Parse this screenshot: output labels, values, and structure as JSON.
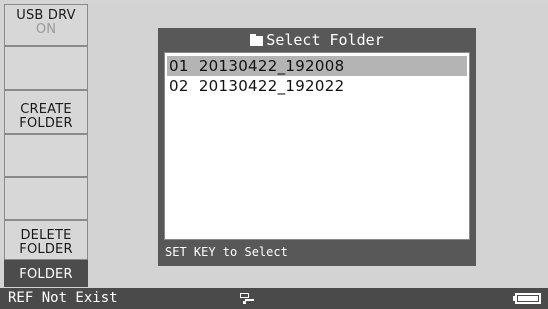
{
  "sidebar": {
    "keys": [
      {
        "label": "USB DRV",
        "sub": "ON"
      },
      {
        "label": ""
      },
      {
        "line1": "CREATE",
        "line2": "FOLDER"
      },
      {
        "label": ""
      },
      {
        "label": ""
      },
      {
        "line1": "DELETE",
        "line2": "FOLDER"
      },
      {
        "label": "FOLDER"
      }
    ]
  },
  "dialog": {
    "title": "Select Folder",
    "items": [
      {
        "label": "01  20130422_192008"
      },
      {
        "label": "02  20130422_192022"
      }
    ],
    "selected_index": 0,
    "hint": "SET KEY to Select"
  },
  "status": {
    "message": "REF Not Exist",
    "icons": [
      "usb-icon",
      "battery-icon"
    ]
  },
  "colors": {
    "background": "#d4d4d4",
    "dialog": "#585858",
    "selection": "#b4b4b4",
    "statusbar": "#4a4a4a"
  }
}
